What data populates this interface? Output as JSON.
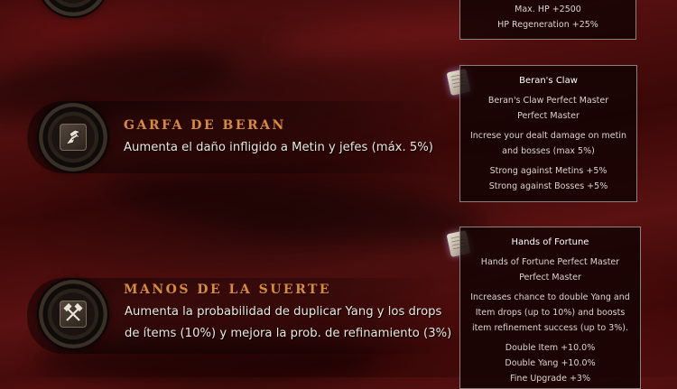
{
  "tooltips": {
    "top": {
      "lines": [
        "Max. HP +2500",
        "HP Regeneration +25%"
      ]
    },
    "berans_claw": {
      "title": "Beran's Claw",
      "rank_line1": "Beran's Claw Perfect Master",
      "rank_line2": "Perfect Master",
      "desc_line1": "Increse your dealt damage on metin",
      "desc_line2": "and bosses (max 5%)",
      "stat1": "Strong against Metins +5%",
      "stat2": "Strong against Bosses +5%"
    },
    "hands_of_fortune": {
      "title": "Hands of Fortune",
      "rank_line1": "Hands of Fortune Perfect Master",
      "rank_line2": "Perfect Master",
      "desc_line1": "Increases chance to double Yang and",
      "desc_line2": "Item drops (up to 10%) and boosts",
      "desc_line3": "item refinement success (up to 3%).",
      "stat1": "Double Item +10.0%",
      "stat2": "Double Yang +10.0%",
      "stat3": "Fine Upgrade +3%"
    }
  },
  "skills": [
    {
      "icon": "claw-icon",
      "title": "GARFA DE BERAN",
      "description": "Aumenta el daño infligido a Metin y jefes (máx. 5%)"
    },
    {
      "icon": "crossed-hammers-icon",
      "title": "MANOS DE LA SUERTE",
      "description_line1": "Aumenta la probabilidad de duplicar Yang y los drops",
      "description_line2": "de ítems (10%) y mejora la prob. de refinamiento (3%)"
    }
  ]
}
